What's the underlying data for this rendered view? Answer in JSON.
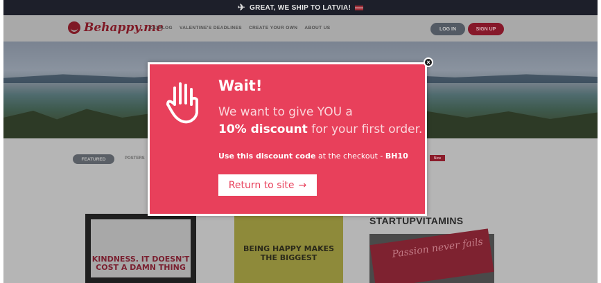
{
  "banner": {
    "icon": "plane-icon",
    "text": "GREAT, WE SHIP TO LATVIA!"
  },
  "header": {
    "logo_text": "Behappy.me",
    "nav": [
      "CATALOG",
      "VALENTINE'S DEADLINES",
      "CREATE YOUR OWN",
      "ABOUT US"
    ],
    "login_label": "LOG IN",
    "signup_label": "SIGN UP"
  },
  "content": {
    "tab_featured": "FEATURED",
    "tab_other": "POSTERS",
    "badge_new": "New",
    "brand_light": "STARTUP",
    "brand_bold": "VITAMINS",
    "poster1_text": "KINDNESS. IT DOESN'T COST A DAMN THING",
    "poster2_text": "BEING HAPPY MAKES THE BIGGEST",
    "poster3_text": "Passion never fails"
  },
  "modal": {
    "title": "Wait!",
    "line1": "We want to give YOU a",
    "line2_bold": "10% discount",
    "line2_rest": " for your first order.",
    "code_bold": "Use this discount code",
    "code_rest": " at the checkout - ",
    "code_value": "BH10",
    "return_label": "Return to site",
    "close_icon": "close-icon",
    "colors": {
      "modal_bg": "#e8405b",
      "accent_text": "#fbd6dc"
    }
  }
}
